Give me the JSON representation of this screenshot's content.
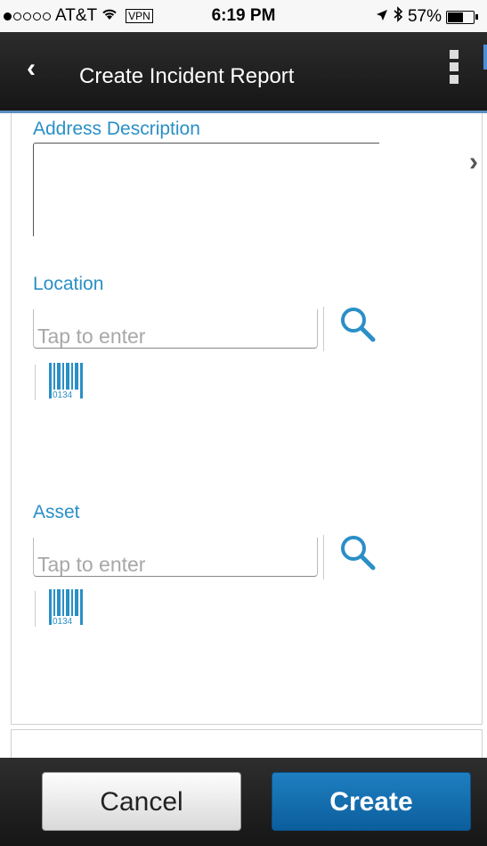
{
  "status_bar": {
    "carrier": "AT&T",
    "vpn": "VPN",
    "time": "6:19 PM",
    "battery": "57%",
    "battery_level": 0.57,
    "signal_bars": 1
  },
  "header": {
    "back_icon": "chevron-left-icon",
    "title": "Create Incident Report",
    "menu_icon": "more-vertical-icon"
  },
  "form": {
    "address_label": "Address Description",
    "address_value": "",
    "location_label": "Location",
    "location_placeholder": "Tap to enter",
    "asset_label": "Asset",
    "asset_placeholder": "Tap to enter",
    "barcode_text": "0134"
  },
  "footer": {
    "cancel_label": "Cancel",
    "create_label": "Create"
  },
  "colors": {
    "accent": "#2a8fc7",
    "primary_button": "#1b78b8",
    "header_bg": "#1f1f1f"
  }
}
